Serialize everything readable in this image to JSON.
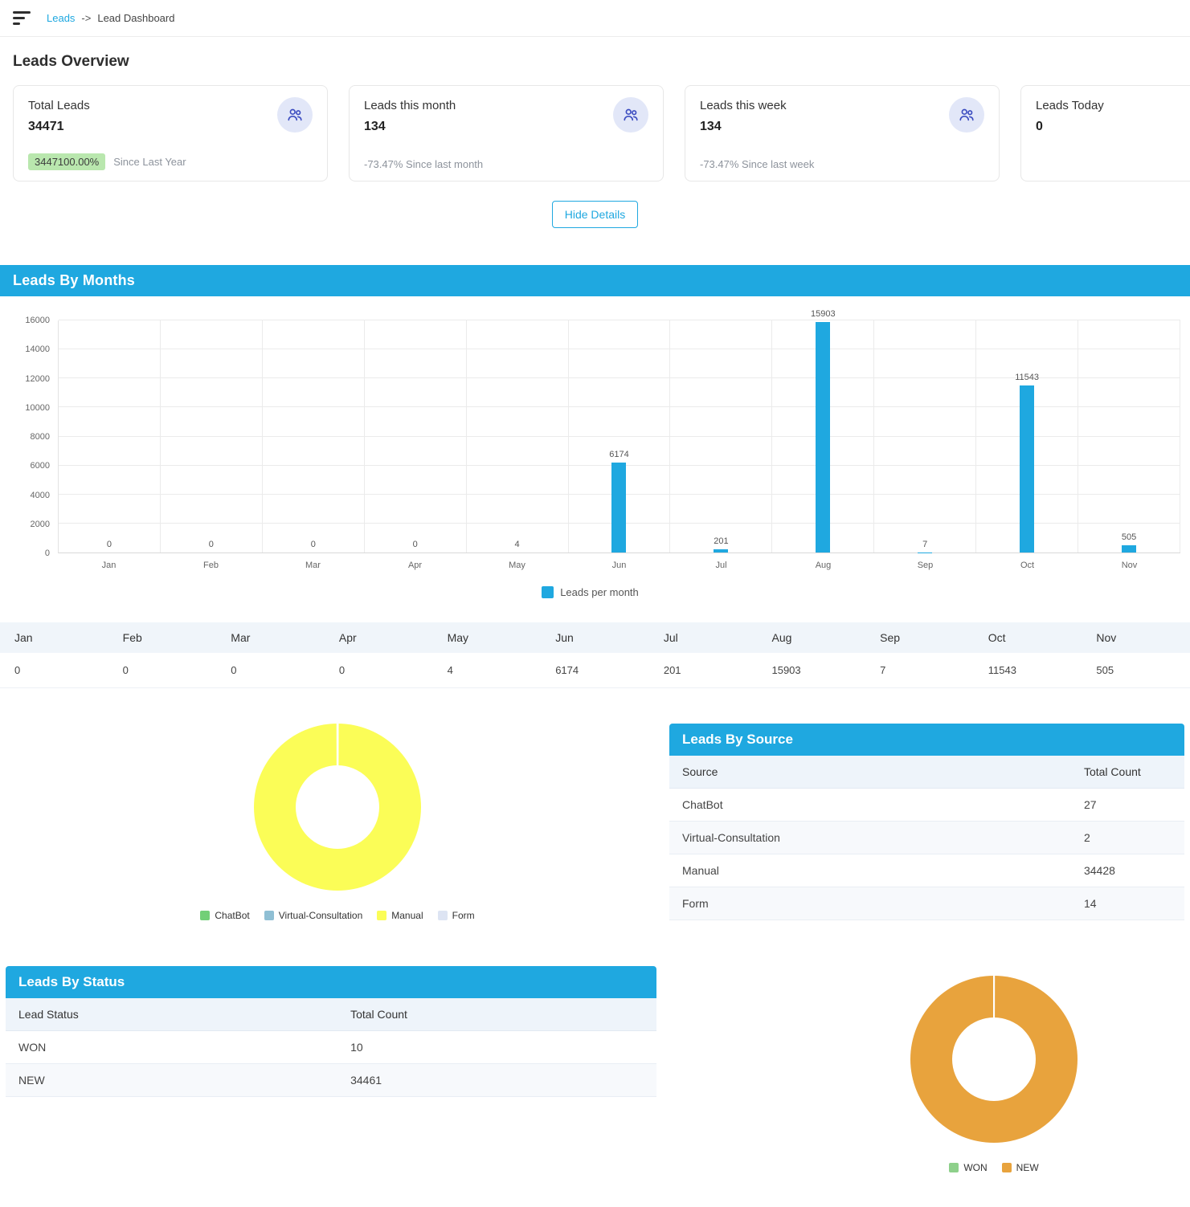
{
  "colors": {
    "accent_blue": "#1fa8e0",
    "badge_green_bg": "#b9e7ae",
    "icon_circle_bg": "#e2e7f8",
    "icon_color": "#3b4cc0"
  },
  "breadcrumb": {
    "link": "Leads",
    "separator": "->",
    "current": "Lead Dashboard"
  },
  "overview": {
    "title": "Leads Overview",
    "hide_details_label": "Hide Details",
    "cards": [
      {
        "label": "Total Leads",
        "value": "34471",
        "badge": "3447100.00%",
        "sub": "Since Last Year"
      },
      {
        "label": "Leads this month",
        "value": "134",
        "sub": "-73.47% Since last month"
      },
      {
        "label": "Leads this week",
        "value": "134",
        "sub": "-73.47% Since last week"
      },
      {
        "label": "Leads Today",
        "value": "0"
      }
    ]
  },
  "sections": {
    "months_title": "Leads By Months",
    "source_title": "Leads By Source",
    "status_title": "Leads By Status"
  },
  "chart_data": [
    {
      "type": "bar",
      "title": "Leads By Months",
      "categories": [
        "Jan",
        "Feb",
        "Mar",
        "Apr",
        "May",
        "Jun",
        "Jul",
        "Aug",
        "Sep",
        "Oct",
        "Nov"
      ],
      "values": [
        0,
        0,
        0,
        0,
        4,
        6174,
        201,
        15903,
        7,
        11543,
        505
      ],
      "ylim": [
        0,
        16000
      ],
      "ytick_step": 2000,
      "grid": true,
      "legend": "Leads per month",
      "legend_position": "bottom",
      "bar_color": "#1fa8e0"
    },
    {
      "type": "pie",
      "title": "Leads By Source",
      "categories": [
        "ChatBot",
        "Virtual-Consultation",
        "Manual",
        "Form"
      ],
      "values": [
        27,
        2,
        34428,
        14
      ],
      "colors": [
        "#72cf77",
        "#8fbfd4",
        "#fbfd57",
        "#dde4f3"
      ],
      "legend_position": "bottom",
      "donut": true
    },
    {
      "type": "pie",
      "title": "Leads By Status",
      "categories": [
        "WON",
        "NEW"
      ],
      "values": [
        10,
        34461
      ],
      "colors": [
        "#8ed08b",
        "#e8a33d"
      ],
      "legend_position": "bottom",
      "donut": true
    }
  ],
  "months_table": {
    "headers": [
      "Jan",
      "Feb",
      "Mar",
      "Apr",
      "May",
      "Jun",
      "Jul",
      "Aug",
      "Sep",
      "Oct",
      "Nov"
    ],
    "values": [
      "0",
      "0",
      "0",
      "0",
      "4",
      "6174",
      "201",
      "15903",
      "7",
      "11543",
      "505"
    ]
  },
  "leads_by_source": {
    "columns": [
      "Source",
      "Total Count"
    ],
    "rows": [
      [
        "ChatBot",
        "27"
      ],
      [
        "Virtual-Consultation",
        "2"
      ],
      [
        "Manual",
        "34428"
      ],
      [
        "Form",
        "14"
      ]
    ]
  },
  "leads_by_status": {
    "columns": [
      "Lead Status",
      "Total Count"
    ],
    "rows": [
      [
        "WON",
        "10"
      ],
      [
        "NEW",
        "34461"
      ]
    ]
  }
}
